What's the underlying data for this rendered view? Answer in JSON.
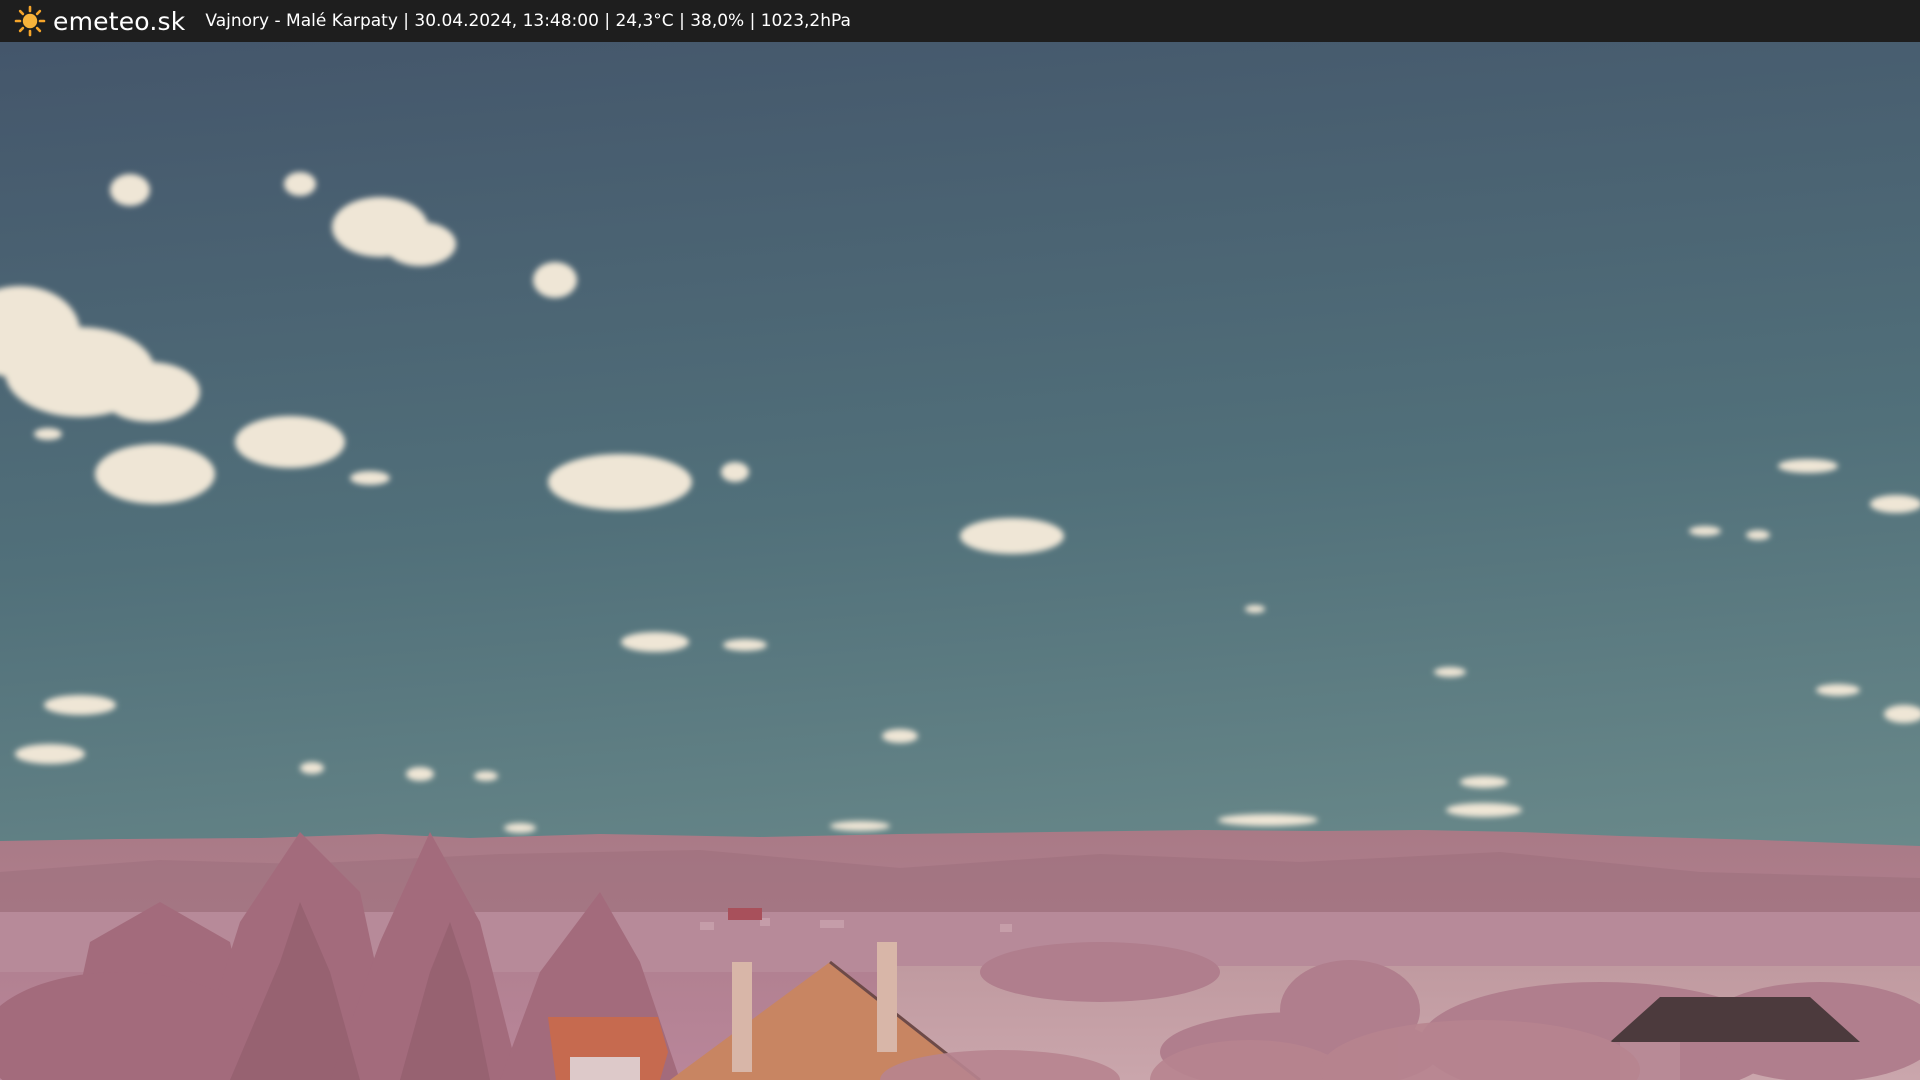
{
  "header": {
    "brand": "emeteo.sk",
    "logo_icon": "sun-icon",
    "caption": "Vajnory - Malé Karpaty | 30.04.2024, 13:48:00 | 24,3°C | 38,0% | 1023,2hPa"
  },
  "colors": {
    "bar_background": "#1e1e1e",
    "sun": "#f6a52a",
    "sky_top": "#465a66",
    "sky_bottom": "#67888a",
    "vegetation": "#b47f8e",
    "roof": "#c66a4f"
  }
}
